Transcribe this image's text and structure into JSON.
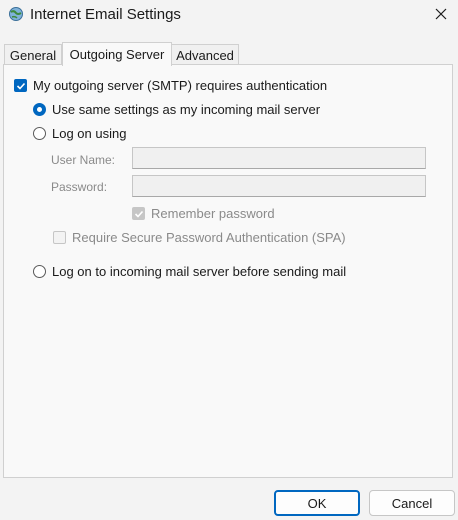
{
  "window": {
    "title": "Internet Email Settings",
    "close_icon": "close-icon"
  },
  "tabs": [
    {
      "label": "General",
      "active": false
    },
    {
      "label": "Outgoing Server",
      "active": true
    },
    {
      "label": "Advanced",
      "active": false
    }
  ],
  "outgoing": {
    "requires_auth": {
      "label": "My outgoing server (SMTP) requires authentication",
      "checked": true
    },
    "use_same": {
      "label": "Use same settings as my incoming mail server",
      "selected": true
    },
    "log_on_using": {
      "label": "Log on using",
      "selected": false
    },
    "user_name": {
      "label": "User Name:",
      "value": ""
    },
    "password": {
      "label": "Password:",
      "value": ""
    },
    "remember_password": {
      "label": "Remember password",
      "checked": true,
      "enabled": false
    },
    "require_spa": {
      "label": "Require Secure Password Authentication (SPA)",
      "checked": false,
      "enabled": false
    },
    "log_on_incoming": {
      "label": "Log on to incoming mail server before sending mail",
      "selected": false
    }
  },
  "buttons": {
    "ok": "OK",
    "cancel": "Cancel"
  },
  "colors": {
    "accent": "#0067c0",
    "background": "#f3f3f3"
  }
}
